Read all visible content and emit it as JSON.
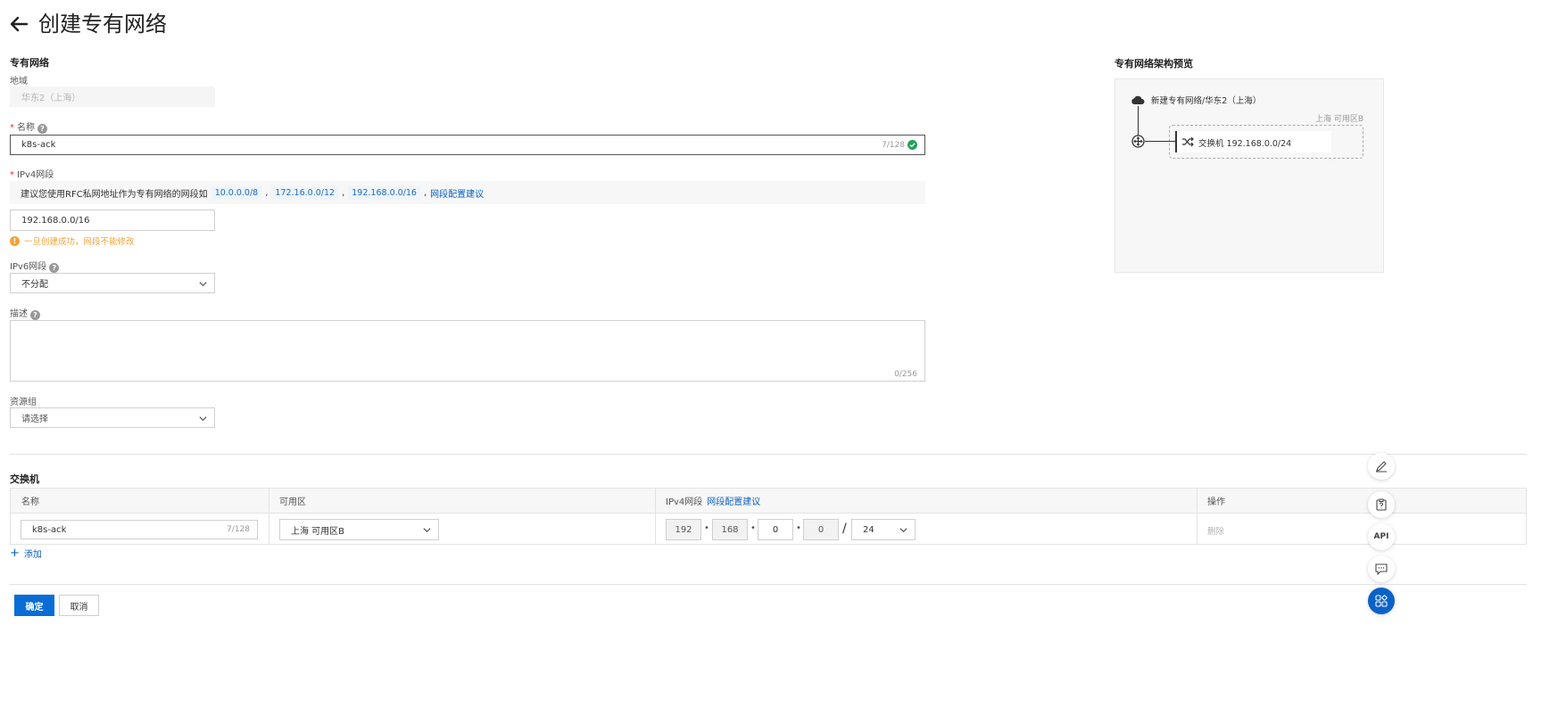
{
  "header": {
    "title": "创建专有网络"
  },
  "vpc_section": {
    "title": "专有网络",
    "region_label": "地域",
    "region_value": "华东2（上海）",
    "name_label": "名称",
    "name_value": "k8s-ack",
    "name_counter": "7/128",
    "ipv4_label": "IPv4网段",
    "ipv4_tip_prefix": "建议您使用RFC私网地址作为专有网络的网段如",
    "ipv4_tip_tags": [
      "10.0.0.0/8",
      "172.16.0.0/12",
      "192.168.0.0/16"
    ],
    "ipv4_tip_sep": ",",
    "ipv4_tip_link": "网段配置建议",
    "ipv4_value": "192.168.0.0/16",
    "ipv4_warning": "一旦创建成功，网段不能修改",
    "ipv6_label": "IPv6网段",
    "ipv6_value": "不分配",
    "desc_label": "描述",
    "desc_value": "",
    "desc_counter": "0/256",
    "rg_label": "资源组",
    "rg_value": "请选择"
  },
  "switch_section": {
    "title": "交换机",
    "columns": {
      "name": "名称",
      "zone": "可用区",
      "ipv4": "IPv4网段",
      "ipv4_link": "网段配置建议",
      "action": "操作"
    },
    "row": {
      "name": "k8s-ack",
      "name_counter": "7/128",
      "zone": "上海 可用区B",
      "ip_octets": [
        "192",
        "168",
        "0",
        "0"
      ],
      "slash": "/",
      "mask": "24",
      "delete_label": "删除"
    },
    "add_label": "添加"
  },
  "footer": {
    "confirm_label": "确定",
    "cancel_label": "取消"
  },
  "preview": {
    "title": "专有网络架构预览",
    "vpc_label": "新建专有网络/华东2（上海）",
    "zone_label": "上海 可用区B",
    "switch_label": "交换机 192.168.0.0/24"
  },
  "float_toolbar": {
    "icons": [
      "edit-icon",
      "clipboard-help-icon",
      "api-icon",
      "chat-icon",
      "apps-icon"
    ],
    "api_text": "API"
  },
  "colors": {
    "primary": "#0a6cd6",
    "link": "#0a62c9",
    "warning": "#f2a33a",
    "success": "#1fa25c",
    "required": "#e62e2e"
  }
}
